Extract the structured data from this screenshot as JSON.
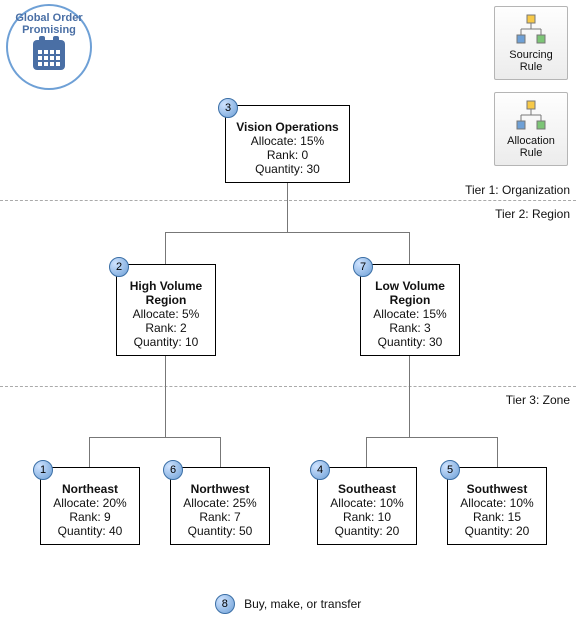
{
  "gop": {
    "line1": "Global Order",
    "line2": "Promising"
  },
  "rules": {
    "sourcing": {
      "line1": "Sourcing",
      "line2": "Rule"
    },
    "allocation": {
      "line1": "Allocation",
      "line2": "Rule"
    }
  },
  "tiers": {
    "t1": "Tier 1: Organization",
    "t2": "Tier 2: Region",
    "t3": "Tier 3: Zone"
  },
  "nodes": {
    "vision": {
      "badge": "3",
      "title": "Vision Operations",
      "allocate": "Allocate: 15%",
      "rank": "Rank: 0",
      "quantity": "Quantity: 30"
    },
    "highv": {
      "badge": "2",
      "title1": "High Volume",
      "title2": "Region",
      "allocate": "Allocate: 5%",
      "rank": "Rank: 2",
      "quantity": "Quantity: 10"
    },
    "lowv": {
      "badge": "7",
      "title1": "Low Volume",
      "title2": "Region",
      "allocate": "Allocate: 15%",
      "rank": "Rank: 3",
      "quantity": "Quantity: 30"
    },
    "ne": {
      "badge": "1",
      "title": "Northeast",
      "allocate": "Allocate: 20%",
      "rank": "Rank: 9",
      "quantity": "Quantity: 40"
    },
    "nw": {
      "badge": "6",
      "title": "Northwest",
      "allocate": "Allocate: 25%",
      "rank": "Rank: 7",
      "quantity": "Quantity: 50"
    },
    "se": {
      "badge": "4",
      "title": "Southeast",
      "allocate": "Allocate: 10%",
      "rank": "Rank: 10",
      "quantity": "Quantity: 20"
    },
    "sw": {
      "badge": "5",
      "title": "Southwest",
      "allocate": "Allocate: 10%",
      "rank": "Rank: 15",
      "quantity": "Quantity: 20"
    }
  },
  "legend": {
    "badge": "8",
    "text": "Buy, make, or transfer"
  },
  "chart_data": {
    "type": "tree",
    "tiers": [
      "Organization",
      "Region",
      "Zone"
    ],
    "root": {
      "name": "Vision Operations",
      "sequence": 3,
      "allocate_pct": 15,
      "rank": 0,
      "quantity": 30,
      "tier": 1,
      "children": [
        {
          "name": "High Volume Region",
          "sequence": 2,
          "allocate_pct": 5,
          "rank": 2,
          "quantity": 10,
          "tier": 2,
          "children": [
            {
              "name": "Northeast",
              "sequence": 1,
              "allocate_pct": 20,
              "rank": 9,
              "quantity": 40,
              "tier": 3
            },
            {
              "name": "Northwest",
              "sequence": 6,
              "allocate_pct": 25,
              "rank": 7,
              "quantity": 50,
              "tier": 3
            }
          ]
        },
        {
          "name": "Low Volume Region",
          "sequence": 7,
          "allocate_pct": 15,
          "rank": 3,
          "quantity": 30,
          "tier": 2,
          "children": [
            {
              "name": "Southeast",
              "sequence": 4,
              "allocate_pct": 10,
              "rank": 10,
              "quantity": 20,
              "tier": 3
            },
            {
              "name": "Southwest",
              "sequence": 5,
              "allocate_pct": 10,
              "rank": 15,
              "quantity": 20,
              "tier": 3
            }
          ]
        }
      ]
    },
    "legend": {
      "sequence": 8,
      "meaning": "Buy, make, or transfer"
    }
  }
}
